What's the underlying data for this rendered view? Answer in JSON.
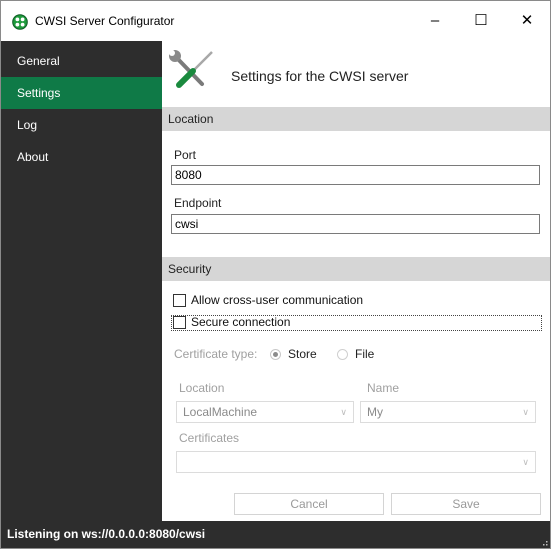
{
  "window": {
    "title": "CWSI Server Configurator",
    "minimize_glyph": "–",
    "maximize_glyph": "☐",
    "close_glyph": "✕",
    "accent_color": "#0f7a47",
    "sidebar_color": "#2d2d2d"
  },
  "sidebar": {
    "items": [
      {
        "label": "General",
        "active": false
      },
      {
        "label": "Settings",
        "active": true
      },
      {
        "label": "Log",
        "active": false
      },
      {
        "label": "About",
        "active": false
      }
    ]
  },
  "header": {
    "icon": "wrench-screwdriver-icon",
    "title": "Settings for the CWSI server"
  },
  "location_section": {
    "title": "Location",
    "port_label": "Port",
    "port_value": "8080",
    "endpoint_label": "Endpoint",
    "endpoint_value": "cwsi"
  },
  "security_section": {
    "title": "Security",
    "allow_cross_user_label": "Allow cross-user communication",
    "allow_cross_user_checked": false,
    "secure_connection_label": "Secure connection",
    "secure_connection_checked": false,
    "certificate_type_label": "Certificate type:",
    "store_label": "Store",
    "file_label": "File",
    "selected_certificate_type": "Store",
    "location_label": "Location",
    "location_value": "LocalMachine",
    "name_label": "Name",
    "name_value": "My",
    "certificates_label": "Certificates",
    "certificates_value": ""
  },
  "buttons": {
    "cancel_label": "Cancel",
    "save_label": "Save"
  },
  "status": {
    "text": "Listening on ws://0.0.0.0:8080/cwsi"
  }
}
